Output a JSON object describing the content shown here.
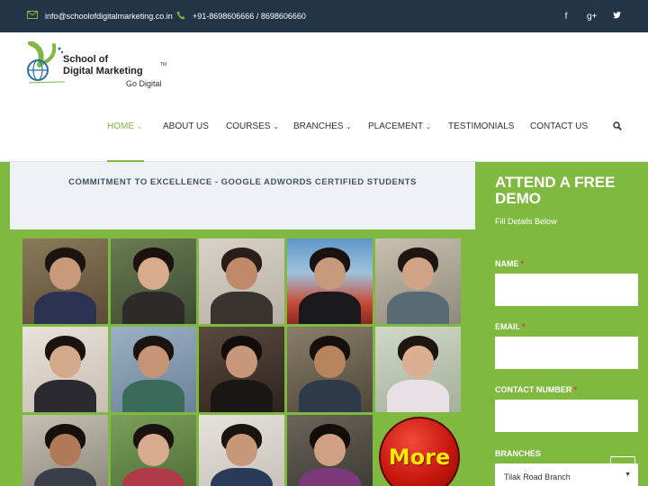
{
  "topbar": {
    "email": "info@schoolofdigitalmarketing.co.in",
    "phone": "+91-8698606666 / 8698606660",
    "social_icons": [
      "facebook-icon",
      "google-plus-icon",
      "twitter-icon"
    ],
    "social_glyphs": [
      "f",
      "g+",
      "t"
    ]
  },
  "logo": {
    "line1": "School of",
    "line2": "Digital Marketing",
    "trademark": "TM",
    "tagline": "Go Digital"
  },
  "nav": {
    "items": [
      {
        "label": "HOME",
        "has_caret": true,
        "active": true
      },
      {
        "label": "ABOUT US",
        "has_caret": false,
        "active": false
      },
      {
        "label": "COURSES",
        "has_caret": true,
        "active": false
      },
      {
        "label": "BRANCHES",
        "has_caret": true,
        "active": false
      },
      {
        "label": "PLACEMENT",
        "has_caret": true,
        "active": false
      },
      {
        "label": "TESTIMONIALS",
        "has_caret": false,
        "active": false
      },
      {
        "label": "CONTACT US",
        "has_caret": false,
        "active": false
      }
    ],
    "caret_glyph": "⌄",
    "search_icon": "search-icon"
  },
  "banner": {
    "text": "COMMITMENT TO EXCELLENCE - GOOGLE ADWORDS CERTIFIED STUDENTS"
  },
  "gallery": {
    "more_label": "More"
  },
  "form": {
    "title": "ATTEND A FREE DEMO",
    "subtitle": "Fill Details Below",
    "required_mark": "*",
    "fields": [
      {
        "label": "NAME",
        "value": ""
      },
      {
        "label": "EMAIL",
        "value": ""
      },
      {
        "label": "CONTACT NUMBER",
        "value": ""
      }
    ],
    "branches_label": "BRANCHES",
    "branch_selected": "Tilak Road Branch"
  },
  "colors": {
    "accent": "#7fb93f",
    "topbar": "#243447",
    "more_button": "#c8160c",
    "more_text": "#ffe800"
  }
}
